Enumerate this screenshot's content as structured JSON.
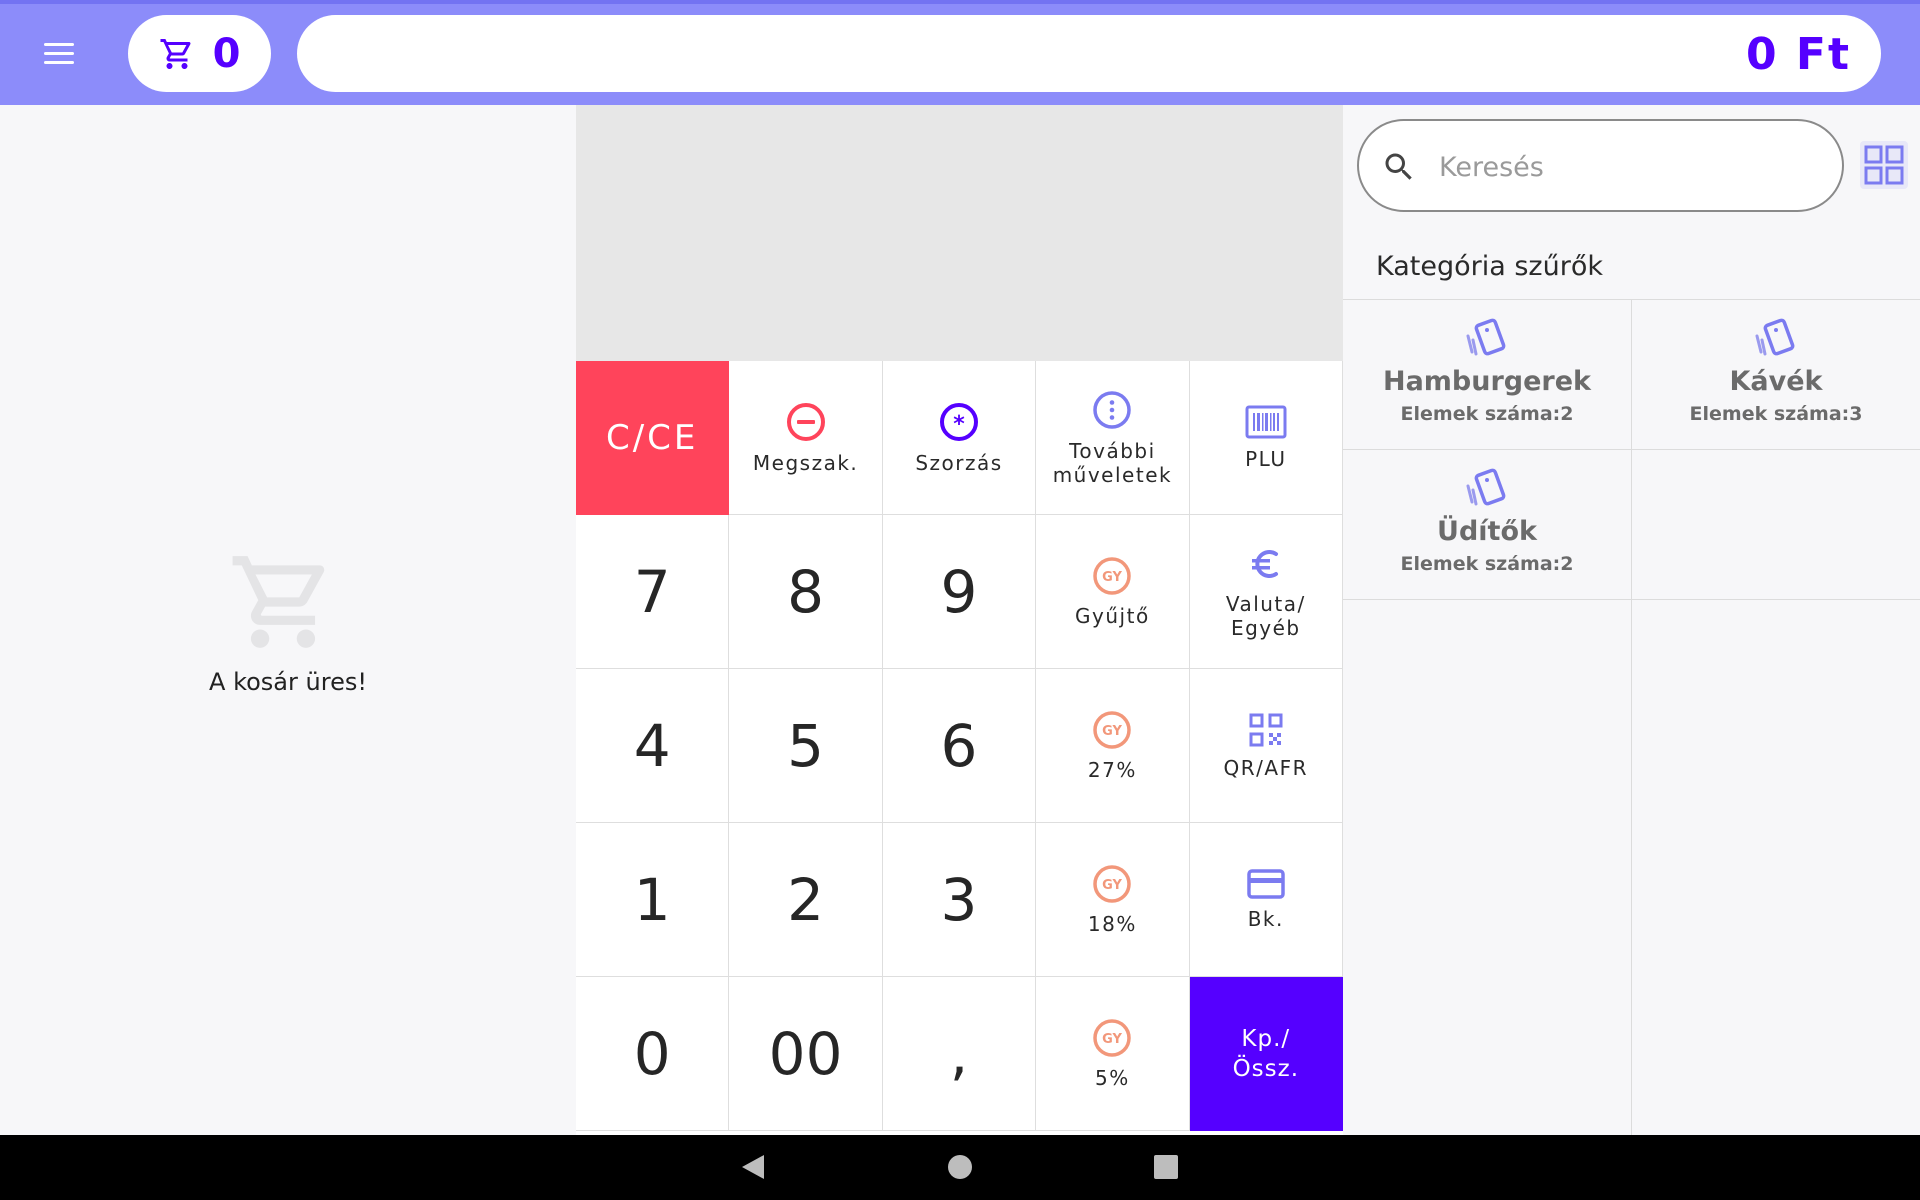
{
  "header": {
    "cart_count": "0",
    "total": "0 Ft"
  },
  "cart": {
    "empty_message": "A kosár üres!"
  },
  "keypad": {
    "clear": "C/CE",
    "cancel": "Megszak.",
    "multiply": "Szorzás",
    "more_ops": "További\nműveletek",
    "plu": "PLU",
    "k7": "7",
    "k8": "8",
    "k9": "9",
    "collector": "Gyűjtő",
    "currency": "Valuta/\nEgyéb",
    "k4": "4",
    "k5": "5",
    "k6": "6",
    "vat27": "27%",
    "qr": "QR/AFR",
    "k1": "1",
    "k2": "2",
    "k3": "3",
    "vat18": "18%",
    "card": "Bk.",
    "k0": "0",
    "k00": "00",
    "comma": ",",
    "vat5": "5%",
    "cash_total": "Kp./\nÖssz.",
    "gy_badge": "GY"
  },
  "search": {
    "placeholder": "Keresés"
  },
  "categories": {
    "header": "Kategória szűrők",
    "items": [
      {
        "name": "Hamburgerek",
        "count": "Elemek száma:2"
      },
      {
        "name": "Kávék",
        "count": "Elemek száma:3"
      },
      {
        "name": "Üdítők",
        "count": "Elemek száma:2"
      }
    ]
  },
  "colors": {
    "accent": "#5500ff",
    "topbar": "#8c8cfa",
    "clear_key": "#ff445b",
    "gy_badge": "#f2977a",
    "icon_violet": "#7b7bf0"
  }
}
